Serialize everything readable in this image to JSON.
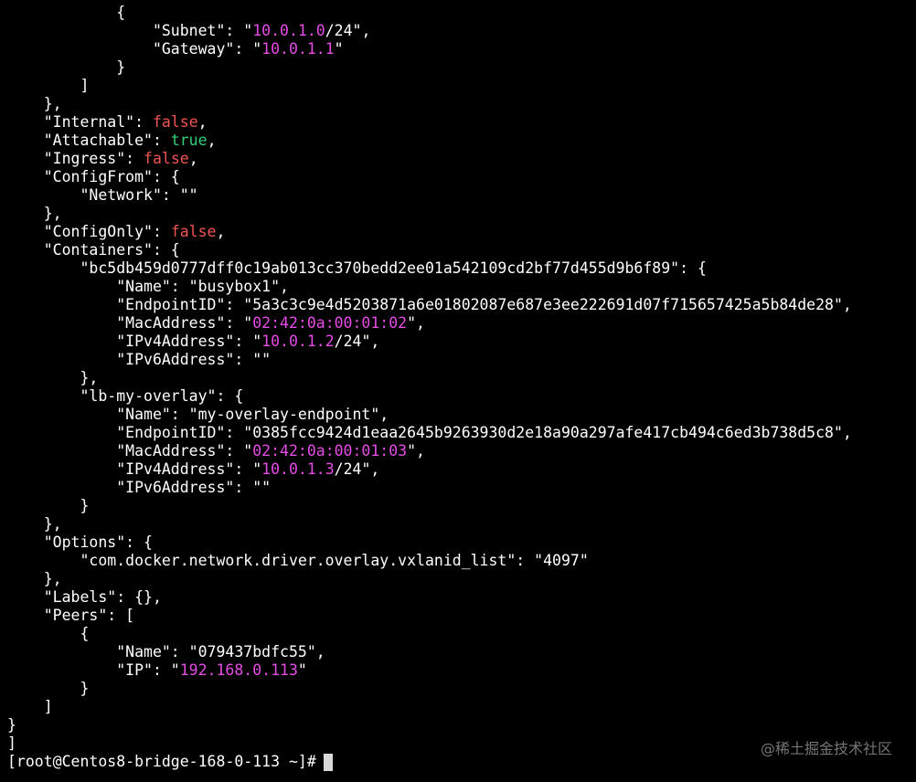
{
  "terminal": {
    "colors": {
      "background": "#000000",
      "text": "#ffffff",
      "string_value": "#e64ce6",
      "false": "#f05454",
      "true": "#33d17a",
      "cursor": "#d9d9d9"
    },
    "lines": [
      [
        {
          "t": "            {",
          "c": "plain"
        }
      ],
      [
        {
          "t": "                \"Subnet\": \"",
          "c": "plain"
        },
        {
          "t": "10.0.1.0",
          "c": "ip"
        },
        {
          "t": "/24\",",
          "c": "plain"
        }
      ],
      [
        {
          "t": "                \"Gateway\": \"",
          "c": "plain"
        },
        {
          "t": "10.0.1.1",
          "c": "ip"
        },
        {
          "t": "\"",
          "c": "plain"
        }
      ],
      [
        {
          "t": "            }",
          "c": "plain"
        }
      ],
      [
        {
          "t": "        ]",
          "c": "plain"
        }
      ],
      [
        {
          "t": "    },",
          "c": "plain"
        }
      ],
      [
        {
          "t": "    \"Internal\": ",
          "c": "plain"
        },
        {
          "t": "false",
          "c": "false"
        },
        {
          "t": ",",
          "c": "plain"
        }
      ],
      [
        {
          "t": "    \"Attachable\": ",
          "c": "plain"
        },
        {
          "t": "true",
          "c": "true"
        },
        {
          "t": ",",
          "c": "plain"
        }
      ],
      [
        {
          "t": "    \"Ingress\": ",
          "c": "plain"
        },
        {
          "t": "false",
          "c": "false"
        },
        {
          "t": ",",
          "c": "plain"
        }
      ],
      [
        {
          "t": "    \"ConfigFrom\": {",
          "c": "plain"
        }
      ],
      [
        {
          "t": "        \"Network\": \"\"",
          "c": "plain"
        }
      ],
      [
        {
          "t": "    },",
          "c": "plain"
        }
      ],
      [
        {
          "t": "    \"ConfigOnly\": ",
          "c": "plain"
        },
        {
          "t": "false",
          "c": "false"
        },
        {
          "t": ",",
          "c": "plain"
        }
      ],
      [
        {
          "t": "    \"Containers\": {",
          "c": "plain"
        }
      ],
      [
        {
          "t": "        \"bc5db459d0777dff0c19ab013cc370bedd2ee01a542109cd2bf77d455d9b6f89\": {",
          "c": "plain"
        }
      ],
      [
        {
          "t": "            \"Name\": \"busybox1\",",
          "c": "plain"
        }
      ],
      [
        {
          "t": "            \"EndpointID\": \"5a3c3c9e4d5203871a6e01802087e687e3ee222691d07f715657425a5b84de28\",",
          "c": "plain"
        }
      ],
      [
        {
          "t": "            \"MacAddress\": \"",
          "c": "plain"
        },
        {
          "t": "02:42:0a:00:01:02",
          "c": "mac"
        },
        {
          "t": "\",",
          "c": "plain"
        }
      ],
      [
        {
          "t": "            \"IPv4Address\": \"",
          "c": "plain"
        },
        {
          "t": "10.0.1.2",
          "c": "ip"
        },
        {
          "t": "/24\",",
          "c": "plain"
        }
      ],
      [
        {
          "t": "            \"IPv6Address\": \"\"",
          "c": "plain"
        }
      ],
      [
        {
          "t": "        },",
          "c": "plain"
        }
      ],
      [
        {
          "t": "        \"lb-my-overlay\": {",
          "c": "plain"
        }
      ],
      [
        {
          "t": "            \"Name\": \"my-overlay-endpoint\",",
          "c": "plain"
        }
      ],
      [
        {
          "t": "            \"EndpointID\": \"0385fcc9424d1eaa2645b9263930d2e18a90a297afe417cb494c6ed3b738d5c8\",",
          "c": "plain"
        }
      ],
      [
        {
          "t": "            \"MacAddress\": \"",
          "c": "plain"
        },
        {
          "t": "02:42:0a:00:01:03",
          "c": "mac"
        },
        {
          "t": "\",",
          "c": "plain"
        }
      ],
      [
        {
          "t": "            \"IPv4Address\": \"",
          "c": "plain"
        },
        {
          "t": "10.0.1.3",
          "c": "ip"
        },
        {
          "t": "/24\",",
          "c": "plain"
        }
      ],
      [
        {
          "t": "            \"IPv6Address\": \"\"",
          "c": "plain"
        }
      ],
      [
        {
          "t": "        }",
          "c": "plain"
        }
      ],
      [
        {
          "t": "    },",
          "c": "plain"
        }
      ],
      [
        {
          "t": "    \"Options\": {",
          "c": "plain"
        }
      ],
      [
        {
          "t": "        \"com.docker.network.driver.overlay.vxlanid_list\": \"4097\"",
          "c": "plain"
        }
      ],
      [
        {
          "t": "    },",
          "c": "plain"
        }
      ],
      [
        {
          "t": "    \"Labels\": {},",
          "c": "plain"
        }
      ],
      [
        {
          "t": "    \"Peers\": [",
          "c": "plain"
        }
      ],
      [
        {
          "t": "        {",
          "c": "plain"
        }
      ],
      [
        {
          "t": "            \"Name\": \"079437bdfc55\",",
          "c": "plain"
        }
      ],
      [
        {
          "t": "            \"IP\": \"",
          "c": "plain"
        },
        {
          "t": "192.168.0.113",
          "c": "ip"
        },
        {
          "t": "\"",
          "c": "plain"
        }
      ],
      [
        {
          "t": "        }",
          "c": "plain"
        }
      ],
      [
        {
          "t": "    ]",
          "c": "plain"
        }
      ],
      [
        {
          "t": "}",
          "c": "plain"
        }
      ],
      [
        {
          "t": "]",
          "c": "plain"
        }
      ]
    ],
    "prompt": "[root@Centos8-bridge-168-0-113 ~]#"
  },
  "watermark": {
    "text": "@稀土掘金技术社区"
  }
}
